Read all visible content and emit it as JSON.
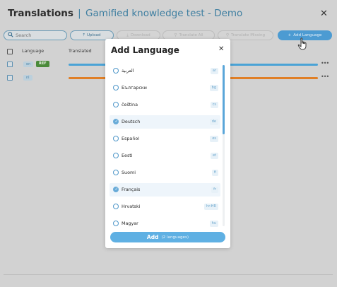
{
  "page": {
    "title": "Translations",
    "subtitle": "Gamified knowledge test - Demo",
    "close_icon": "close-icon"
  },
  "toolbar": {
    "search_placeholder": "Search",
    "upload_label": "Upload",
    "download_label": "Download",
    "translate_all_label": "Translate All",
    "translate_missing_label": "Translate Missing",
    "add_language_label": "Add Language"
  },
  "table": {
    "col_language": "Language",
    "col_translated": "Translated",
    "rows": [
      {
        "code": "en",
        "badge": "REF",
        "progress": 1.0,
        "color": "#4aa3d6"
      },
      {
        "code": "nl",
        "badge": "",
        "progress": 1.0,
        "color": "#e07f26"
      }
    ]
  },
  "modal": {
    "title": "Add Language",
    "languages": [
      {
        "name": "العربية",
        "code": "ar",
        "selected": false
      },
      {
        "name": "Български",
        "code": "bg",
        "selected": false
      },
      {
        "name": "čeština",
        "code": "cs",
        "selected": false
      },
      {
        "name": "Deutsch",
        "code": "de",
        "selected": true
      },
      {
        "name": "Español",
        "code": "es",
        "selected": false
      },
      {
        "name": "Eesti",
        "code": "et",
        "selected": false
      },
      {
        "name": "Suomi",
        "code": "fi",
        "selected": false
      },
      {
        "name": "Français",
        "code": "fr",
        "selected": true
      },
      {
        "name": "Hrvatski",
        "code": "hr-HR",
        "selected": false
      },
      {
        "name": "Magyar",
        "code": "hu",
        "selected": false
      }
    ],
    "add_label": "Add",
    "add_count": "(2 languages)"
  },
  "colors": {
    "accent": "#4c9bd2",
    "ref_badge": "#4a8a3a"
  }
}
